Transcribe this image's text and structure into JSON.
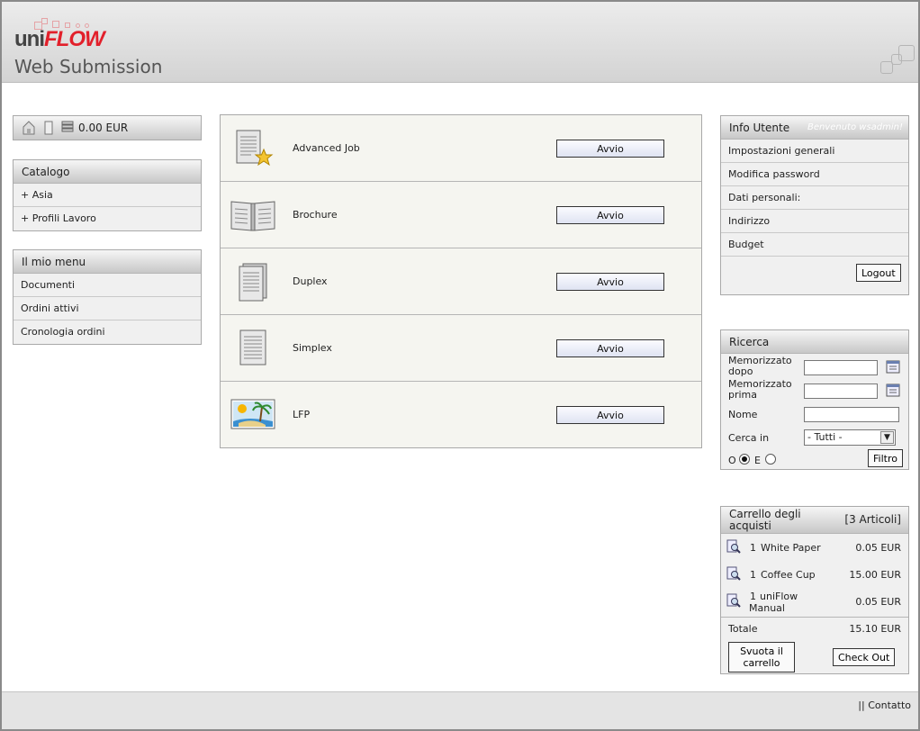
{
  "header": {
    "logo_uni": "uni",
    "logo_flow": "FLOW",
    "title": "Web Submission"
  },
  "balance": {
    "amount": "0.00 EUR",
    "icons": [
      "home-icon",
      "document-icon",
      "database-icon"
    ]
  },
  "catalog": {
    "title": "Catalogo",
    "items": [
      {
        "label": "+ Asia"
      },
      {
        "label": "+ Profili Lavoro"
      }
    ]
  },
  "my_menu": {
    "title": "Il mio menu",
    "items": [
      {
        "label": "Documenti"
      },
      {
        "label": "Ordini attivi"
      },
      {
        "label": "Cronologia ordini"
      }
    ]
  },
  "jobs": [
    {
      "name": "Advanced Job",
      "button": "Avvio",
      "icon": "document-star-icon"
    },
    {
      "name": "Brochure",
      "button": "Avvio",
      "icon": "open-book-icon"
    },
    {
      "name": "Duplex",
      "button": "Avvio",
      "icon": "duplex-document-icon"
    },
    {
      "name": "Simplex",
      "button": "Avvio",
      "icon": "simplex-document-icon"
    },
    {
      "name": "LFP",
      "button": "Avvio",
      "icon": "landscape-image-icon"
    }
  ],
  "user_info": {
    "title": "Info Utente",
    "welcome": "Benvenuto wsadmin!",
    "items": [
      {
        "label": "Impostazioni generali"
      },
      {
        "label": "Modifica password"
      },
      {
        "label": "Dati personali:"
      },
      {
        "label": "Indirizzo"
      },
      {
        "label": "Budget"
      }
    ],
    "logout": "Logout"
  },
  "search": {
    "title": "Ricerca",
    "stored_after_label": "Memorizzato dopo",
    "stored_before_label": "Memorizzato prima",
    "name_label": "Nome",
    "search_in_label": "Cerca in",
    "search_in_value": "- Tutti -",
    "or_label": "O",
    "and_label": "E",
    "filter_button": "Filtro"
  },
  "cart": {
    "title": "Carrello degli acquisti",
    "count": "[3 Articoli]",
    "items": [
      {
        "qty": "1",
        "name": "White Paper",
        "price": "0.05 EUR"
      },
      {
        "qty": "1",
        "name": "Coffee Cup",
        "price": "15.00 EUR"
      },
      {
        "qty": "1",
        "name": "uniFlow Manual",
        "price": "0.05 EUR"
      }
    ],
    "total_label": "Totale",
    "total_value": "15.10 EUR",
    "empty_button": "Svuota il carrello",
    "checkout_button": "Check Out"
  },
  "footer": {
    "contact": "|| Contatto"
  }
}
